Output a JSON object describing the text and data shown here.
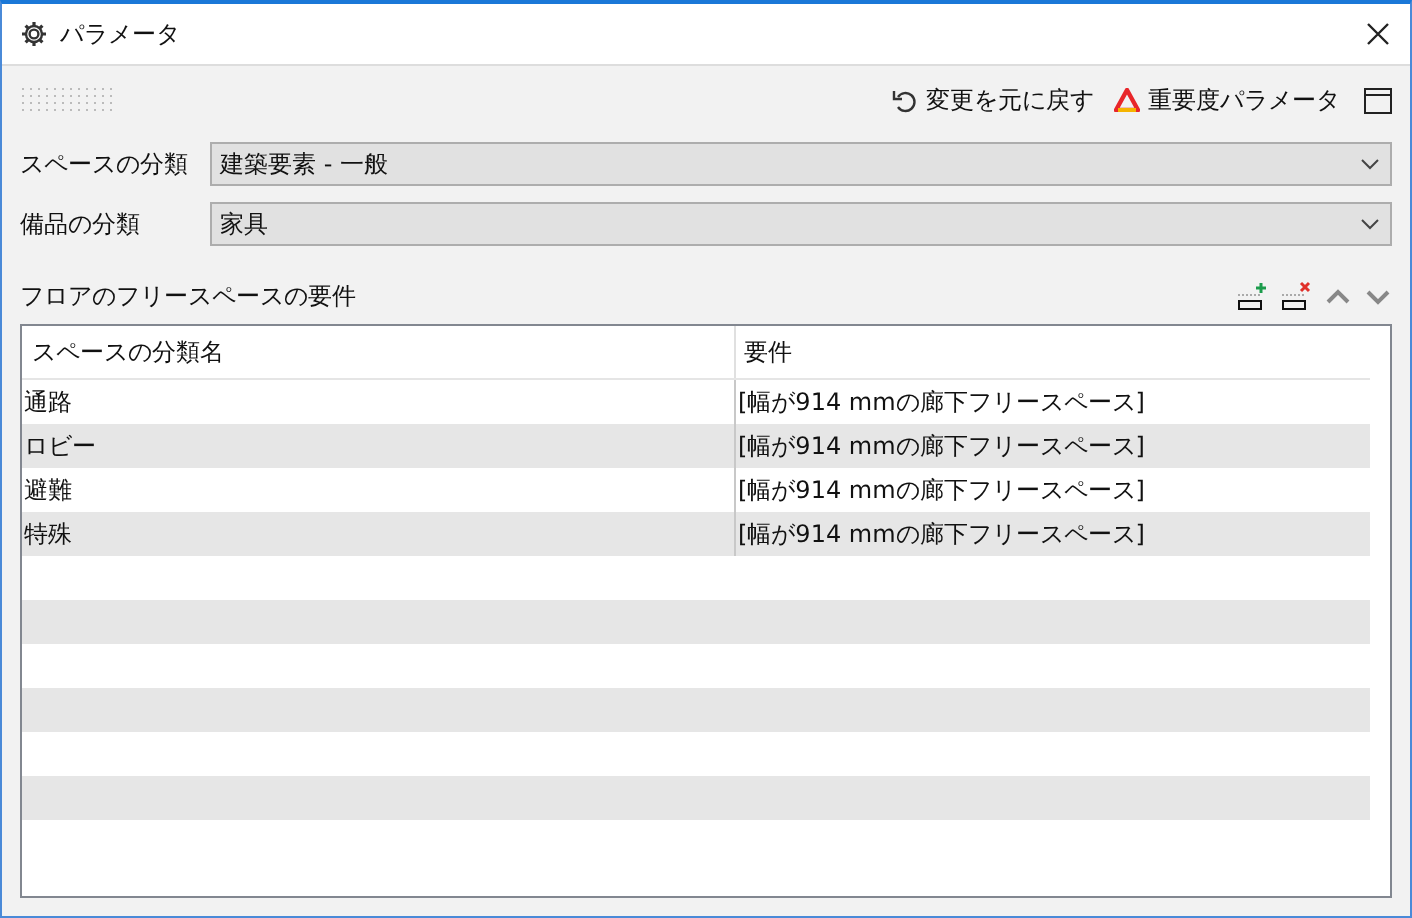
{
  "window": {
    "title": "パラメータ"
  },
  "toolbar": {
    "undo": "変更を元に戻す",
    "severity": "重要度パラメータ"
  },
  "fields": [
    {
      "label": "スペースの分類",
      "value": "建築要素 - 一般"
    },
    {
      "label": "備品の分類",
      "value": "家具"
    }
  ],
  "section": {
    "title": "フロアのフリースペースの要件"
  },
  "table": {
    "columns": [
      "スペースの分類名",
      "要件"
    ],
    "rows": [
      [
        "通路",
        "[幅が914 mmの廊下フリースペース]"
      ],
      [
        "ロビー",
        "[幅が914 mmの廊下フリースペース]"
      ],
      [
        "避難",
        "[幅が914 mmの廊下フリースペース]"
      ],
      [
        "特殊",
        "[幅が914 mmの廊下フリースペース]"
      ]
    ]
  }
}
